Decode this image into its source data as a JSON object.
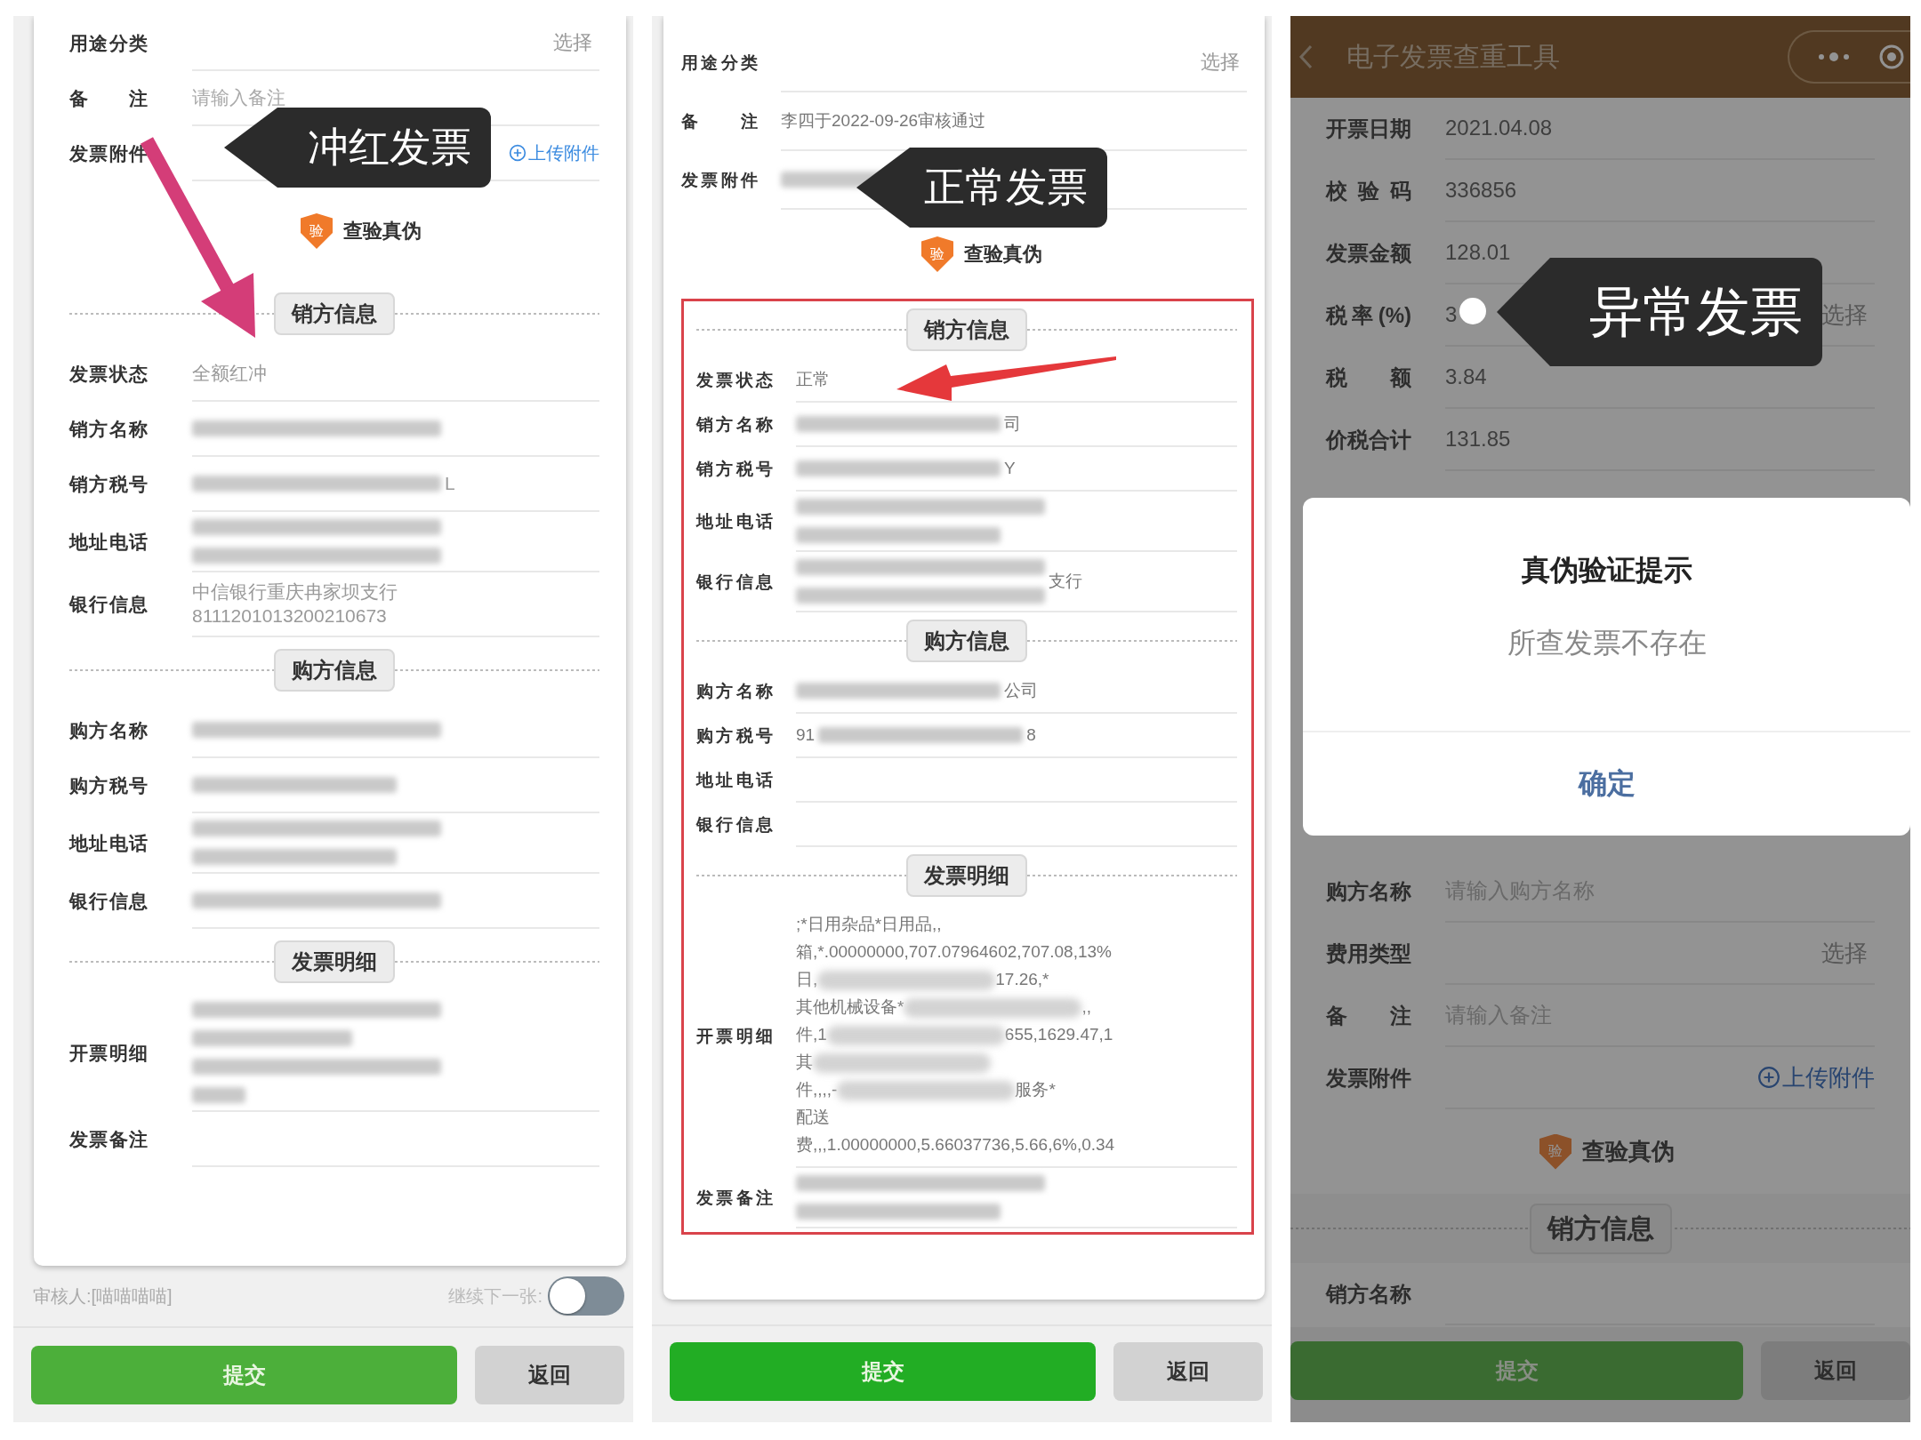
{
  "panels": [
    {
      "tag": {
        "text": "冲红发票"
      },
      "marker": {
        "kind": "arrow_down"
      },
      "items": [
        {
          "kind": "field",
          "label": "用途分类",
          "action": "选择"
        },
        {
          "kind": "field",
          "label": "备注",
          "placeholder": "请输入备注"
        },
        {
          "kind": "field",
          "label": "发票附件",
          "link": "上传附件"
        },
        {
          "kind": "verify",
          "badge": "验",
          "label": "查验真伪"
        },
        {
          "kind": "section",
          "title": "销方信息"
        },
        {
          "kind": "field",
          "label": "发票状态",
          "value": "全额红冲"
        },
        {
          "kind": "field",
          "label": "销方名称",
          "redacted": [
            {
              "kind": "long"
            }
          ]
        },
        {
          "kind": "field",
          "label": "销方税号",
          "redacted": [
            {
              "kind": "long"
            }
          ],
          "suffix": "L"
        },
        {
          "kind": "field",
          "label": "地址电话",
          "redacted": [
            {
              "kind": "long"
            },
            {
              "kind": "long"
            }
          ]
        },
        {
          "kind": "field",
          "label": "银行信息",
          "value": "中信银行重庆冉家坝支行\n8111201013200210673"
        },
        {
          "kind": "section",
          "title": "购方信息"
        },
        {
          "kind": "field",
          "label": "购方名称",
          "redacted": [
            {
              "kind": "long"
            }
          ]
        },
        {
          "kind": "field",
          "label": "购方税号",
          "redacted": [
            {
              "kind": "medium"
            }
          ]
        },
        {
          "kind": "field",
          "label": "地址电话",
          "redacted": [
            {
              "kind": "long"
            },
            {
              "kind": "medium"
            }
          ]
        },
        {
          "kind": "field",
          "label": "银行信息",
          "redacted": [
            {
              "kind": "long"
            }
          ]
        },
        {
          "kind": "section",
          "title": "发票明细"
        },
        {
          "kind": "field",
          "label": "开票明细",
          "redacted": [
            {
              "kind": "long"
            },
            {
              "kind": "short"
            },
            {
              "kind": "long"
            },
            {
              "kind": "tiny"
            }
          ]
        },
        {
          "kind": "field",
          "label": "发票备注"
        }
      ],
      "footer": {
        "reviewer": "审核人:[喵喵喵喵]",
        "toggle": {
          "label": "继续下一张:",
          "on": false
        },
        "buttons": [
          {
            "label": "提交",
            "kind": "primary"
          },
          {
            "label": "返回",
            "kind": "secondary"
          }
        ]
      }
    },
    {
      "tag": {
        "text": "正常发票"
      },
      "marker": {
        "kind": "arrow_left"
      },
      "items": [
        {
          "kind": "field",
          "label": "用途分类",
          "action": "选择"
        },
        {
          "kind": "field",
          "label": "备注",
          "value": "李四于2022-09-26审核通过"
        },
        {
          "kind": "field",
          "label": "发票附件",
          "redacted": [
            {
              "kind": "medium"
            }
          ]
        },
        {
          "kind": "verify",
          "badge": "验",
          "label": "查验真伪"
        }
      ],
      "highlighted_items": [
        {
          "kind": "section",
          "title": "销方信息"
        },
        {
          "kind": "field",
          "label": "发票状态",
          "value": "正常"
        },
        {
          "kind": "field",
          "label": "销方名称",
          "redacted": [
            {
              "kind": "medium"
            }
          ],
          "suffix": "司"
        },
        {
          "kind": "field",
          "label": "销方税号",
          "redacted": [
            {
              "kind": "medium"
            }
          ],
          "suffix": "Y"
        },
        {
          "kind": "field",
          "label": "地址电话",
          "redacted": [
            {
              "kind": "long"
            },
            {
              "kind": "medium"
            }
          ]
        },
        {
          "kind": "field",
          "label": "银行信息",
          "redacted": [
            {
              "kind": "long"
            },
            {
              "kind": "long"
            }
          ],
          "suffix": "支行"
        },
        {
          "kind": "section",
          "title": "购方信息"
        },
        {
          "kind": "field",
          "label": "购方名称",
          "redacted": [
            {
              "kind": "medium"
            }
          ],
          "suffix": "公司"
        },
        {
          "kind": "field",
          "label": "购方税号",
          "prefix": "91",
          "redacted": [
            {
              "kind": "medium"
            }
          ],
          "suffix": "8"
        },
        {
          "kind": "field",
          "label": "地址电话"
        },
        {
          "kind": "field",
          "label": "银行信息"
        },
        {
          "kind": "section",
          "title": "发票明细"
        },
        {
          "kind": "field",
          "label": "开票明细",
          "lines": [
            {
              "start": ";*日用杂品*日用品,,",
              "blurred": false
            },
            {
              "start": "箱,*.00000000,707.07964602,707.08,13%",
              "blurred": false
            },
            {
              "start": "日,",
              "blurred": true,
              "end": "17.26,*"
            },
            {
              "start": "其他机械设备*",
              "blurred": true,
              "end": ",,"
            },
            {
              "start": "件,1",
              "blurred": true,
              "end": "655,1629.47,1"
            },
            {
              "start": "其",
              "blurred": true
            },
            {
              "start": "件,,,,-",
              "blurred": true,
              "end": "服务*"
            },
            {
              "start": "配送",
              "blurred": false
            },
            {
              "start": "费,,,1.00000000,5.66037736,5.66,6%,0.34",
              "blurred": false
            }
          ]
        },
        {
          "kind": "field",
          "label": "发票备注",
          "redacted": [
            {
              "kind": "long"
            },
            {
              "kind": "medium"
            }
          ]
        }
      ],
      "footer": {
        "buttons": [
          {
            "label": "提交",
            "kind": "primary"
          },
          {
            "label": "返回",
            "kind": "secondary"
          }
        ]
      }
    },
    {
      "tag": {
        "text": "异常发票"
      },
      "marker": {
        "kind": "dot"
      },
      "dimmed": true,
      "header": {
        "title": "电子发票查重工具"
      },
      "items": [
        {
          "kind": "field",
          "label": "开票日期",
          "value": "2021.04.08"
        },
        {
          "kind": "field",
          "label": "校验码",
          "value": "336856"
        },
        {
          "kind": "field",
          "label": "发票金额",
          "value": "128.01"
        },
        {
          "kind": "field",
          "label": "税率(%)",
          "value": "3",
          "action": "选择"
        },
        {
          "kind": "field",
          "label": "税额",
          "value": "3.84"
        },
        {
          "kind": "field",
          "label": "价税合计",
          "value": "131.85"
        },
        {
          "kind": "dialog",
          "title": "真伪验证提示",
          "message": "所查发票不存在",
          "button": "确定"
        },
        {
          "kind": "field",
          "label": "购方名称",
          "placeholder": "请输入购方名称"
        },
        {
          "kind": "field",
          "label": "费用类型",
          "action": "选择"
        },
        {
          "kind": "field",
          "label": "备注",
          "placeholder": "请输入备注"
        },
        {
          "kind": "field",
          "label": "发票附件",
          "link": "上传附件"
        },
        {
          "kind": "verify",
          "badge": "验",
          "label": "查验真伪"
        },
        {
          "kind": "section",
          "title": "销方信息"
        },
        {
          "kind": "field",
          "label": "销方名称"
        }
      ],
      "footer": {
        "buttons": [
          {
            "label": "提交",
            "kind": "primary"
          },
          {
            "label": "返回",
            "kind": "secondary"
          }
        ]
      }
    }
  ]
}
